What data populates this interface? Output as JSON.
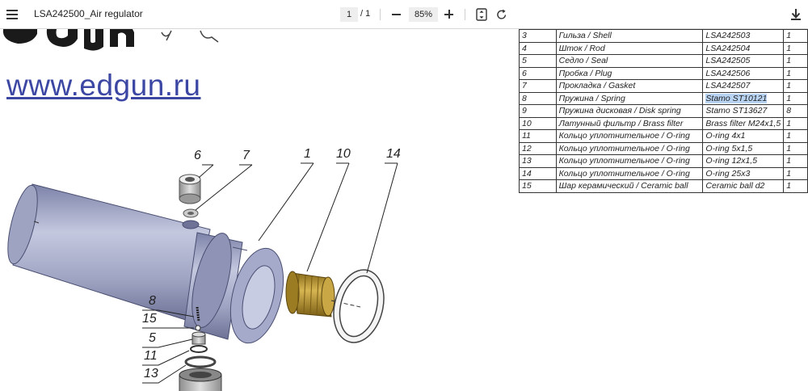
{
  "toolbar": {
    "title": "LSA242500_Air regulator",
    "page_current": "1",
    "page_total": "/ 1",
    "zoom": "85%"
  },
  "document": {
    "website": "www.edgun.ru",
    "logo_text": "edgun"
  },
  "parts_table": [
    {
      "num": "3",
      "name": "Гильза / Shell",
      "code": "LSA242503",
      "qty": "1"
    },
    {
      "num": "4",
      "name": "Шток / Rod",
      "code": "LSA242504",
      "qty": "1"
    },
    {
      "num": "5",
      "name": "Седло / Seal",
      "code": "LSA242505",
      "qty": "1"
    },
    {
      "num": "6",
      "name": "Пробка / Plug",
      "code": "LSA242506",
      "qty": "1"
    },
    {
      "num": "7",
      "name": "Прокладка / Gasket",
      "code": "LSA242507",
      "qty": "1"
    },
    {
      "num": "8",
      "name": "Пружина / Spring",
      "code": "Stamo ST10121",
      "qty": "1"
    },
    {
      "num": "9",
      "name": "Пружина дисковая / Disk spring",
      "code": "Stamo ST13627",
      "qty": "8"
    },
    {
      "num": "10",
      "name": "Латунный  фильтр / Brass filter",
      "code": "Brass filter M24x1,5",
      "qty": "1"
    },
    {
      "num": "11",
      "name": "Кольцо уплотнительное / O-ring",
      "code": "O-ring 4x1",
      "qty": "1"
    },
    {
      "num": "12",
      "name": "Кольцо уплотнительное / O-ring",
      "code": "O-ring 5x1,5",
      "qty": "1"
    },
    {
      "num": "13",
      "name": "Кольцо уплотнительное / O-ring",
      "code": "O-ring 12x1,5",
      "qty": "1"
    },
    {
      "num": "14",
      "name": "Кольцо уплотнительное / O-ring",
      "code": "O-ring 25x3",
      "qty": "1"
    },
    {
      "num": "15",
      "name": "Шар керамический / Ceramic ball",
      "code": "Ceramic ball d2",
      "qty": "1"
    }
  ],
  "callouts": {
    "c6": "6",
    "c7": "7",
    "c1": "1",
    "c10": "10",
    "c14": "14",
    "c8": "8",
    "c15": "15",
    "c5": "5",
    "c11": "11",
    "c13": "13"
  },
  "colors": {
    "link": "#3c47a4",
    "highlight": "#b9d4f2",
    "brass": "#b8962e",
    "body_metal": "#9ea3c2"
  }
}
